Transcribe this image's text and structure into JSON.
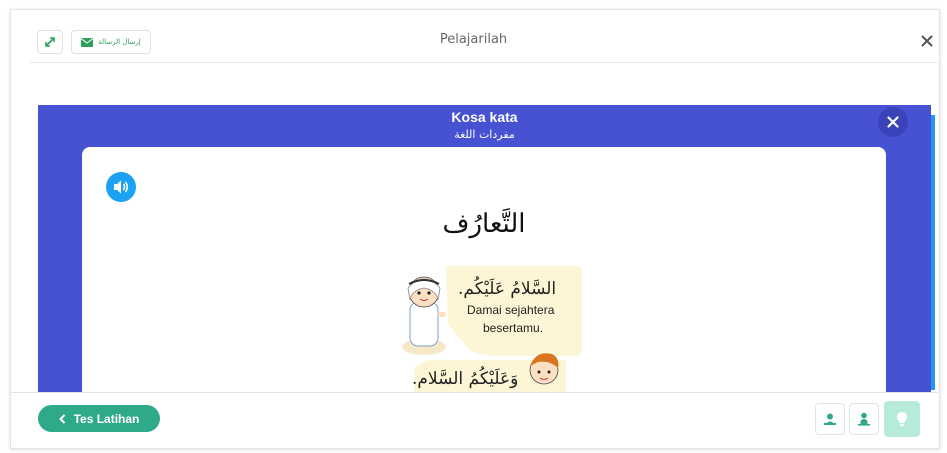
{
  "header": {
    "title": "Pelajarilah",
    "send_message_label": "إرسال الرسالة",
    "expand_icon": "expand-icon",
    "close_icon": "close-icon"
  },
  "modal": {
    "title": "Kosa kata",
    "subtitle": "مفردات اللغة",
    "close_icon": "close-icon",
    "card": {
      "audio_icon": "speaker-icon",
      "heading": "التَّعارُف",
      "dialog": [
        {
          "arabic": "السَّلامُ عَلَيْكُم.",
          "translation_line1": "Damai sejahtera",
          "translation_line2": "besertamu."
        },
        {
          "arabic": "وَعَلَيْكُمُ السَّلام."
        }
      ]
    }
  },
  "footer": {
    "back_button_label": "Tes Latihan",
    "tool_icons": [
      "teacher-icon",
      "student-icon",
      "lightbulb-icon"
    ]
  },
  "colors": {
    "modal_bg": "#4652d2",
    "accent_green": "#2ea98a",
    "audio_blue": "#1da1f2"
  }
}
